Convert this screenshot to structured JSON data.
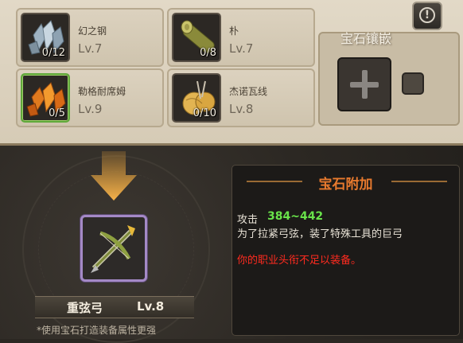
{
  "materials": [
    {
      "name": "幻之钢",
      "level": "Lv.7",
      "count": "0/12",
      "icon": "crystal-icon",
      "highlighted": false
    },
    {
      "name": "朴",
      "level": "Lv.7",
      "count": "0/8",
      "icon": "log-icon",
      "highlighted": false
    },
    {
      "name": "勒格耐席姆",
      "level": "Lv.9",
      "count": "0/5",
      "icon": "orange-crystal-icon",
      "highlighted": true
    },
    {
      "name": "杰诺瓦线",
      "level": "Lv.8",
      "count": "0/10",
      "icon": "yarn-icon",
      "highlighted": false
    }
  ],
  "gem_socket": {
    "title": "宝石镶嵌"
  },
  "info_button": {
    "label": "!"
  },
  "item": {
    "name": "重弦弓",
    "level": "Lv.8",
    "icon": "crossbow-icon"
  },
  "footer_note": "*使用宝石打造装备属性更强",
  "gem_bonus": {
    "title": "宝石附加",
    "attack_label": "攻击",
    "attack_value": "384~442",
    "description": "为了拉紧弓弦，装了特殊工具的巨弓",
    "warning": "你的职业头衔不足以装备。"
  },
  "colors": {
    "attack_value": "#69e34a",
    "warning": "#ff2b1f",
    "title": "#e87a2e",
    "item_frame": "#a489c6"
  }
}
